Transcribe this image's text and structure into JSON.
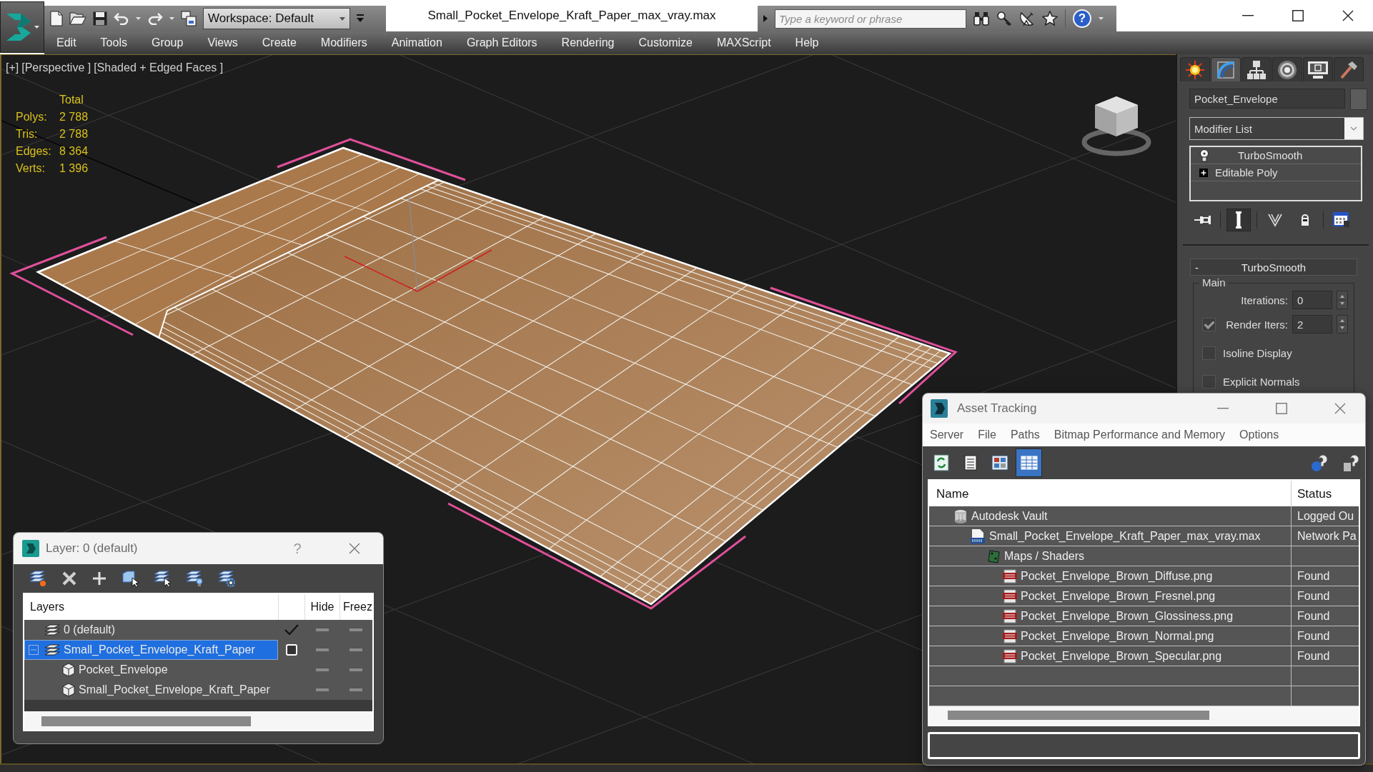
{
  "app": {
    "title": "Small_Pocket_Envelope_Kraft_Paper_max_vray.max",
    "workspace": "Workspace: Default",
    "search": {
      "placeholder": "Type a keyword or phrase"
    },
    "help_symbol": "?"
  },
  "menu": [
    "Edit",
    "Tools",
    "Group",
    "Views",
    "Create",
    "Modifiers",
    "Animation",
    "Graph Editors",
    "Rendering",
    "Customize",
    "MAXScript",
    "Help"
  ],
  "viewport": {
    "labels": [
      "[+]",
      "[Perspective ]",
      "[Shaded + Edged Faces ]"
    ],
    "stats": {
      "header": "Total",
      "rows": [
        {
          "label": "Polys:",
          "value": "2 788"
        },
        {
          "label": "Tris:",
          "value": "2 788"
        },
        {
          "label": "Edges:",
          "value": "8 364"
        },
        {
          "label": "Verts:",
          "value": "1 396"
        }
      ]
    }
  },
  "command_panel": {
    "tabs": [
      {
        "selected": false
      },
      {
        "selected": true
      },
      {
        "selected": false
      },
      {
        "selected": false
      },
      {
        "selected": false
      },
      {
        "selected": false
      }
    ],
    "object_name": "Pocket_Envelope",
    "modifier_list": "Modifier List",
    "stack": [
      {
        "kind": "modifier",
        "label": "TurboSmooth",
        "selected": false
      },
      {
        "kind": "base",
        "label": "Editable Poly",
        "selected": false
      }
    ],
    "stack_tools": [
      {
        "pressed": false
      },
      {
        "pressed": true
      },
      {
        "pressed": false
      },
      {
        "pressed": false
      },
      {
        "pressed": false
      }
    ],
    "rollout": {
      "sign": "-",
      "title": "TurboSmooth",
      "group": "Main",
      "rows": [
        {
          "kind": "spinner",
          "label": "Iterations:",
          "value": "0"
        },
        {
          "kind": "spinner",
          "label": "Render Iters:",
          "value": "2",
          "checked": true
        },
        {
          "kind": "checkbox",
          "label": "Isoline Display",
          "checked": false
        },
        {
          "kind": "checkbox",
          "label": "Explicit Normals",
          "checked": false
        }
      ]
    }
  },
  "asset_tracking": {
    "title": "Asset Tracking",
    "menu": [
      "Server",
      "File",
      "Paths",
      "Bitmap Performance and Memory",
      "Options"
    ],
    "toolbar": [
      {
        "selected": false
      },
      {
        "selected": false
      },
      {
        "selected": false
      },
      {
        "selected": true
      }
    ],
    "columns": [
      "Name",
      "Status"
    ],
    "tree": [
      {
        "kind": "vault",
        "name": "Autodesk Vault",
        "status": "Logged Ou",
        "selected": false,
        "children": [
          {
            "kind": "scene",
            "name": "Small_Pocket_Envelope_Kraft_Paper_max_vray.max",
            "status": "Network Pa",
            "selected": false,
            "children": [
              {
                "kind": "folder",
                "name": "Maps / Shaders",
                "selected": false,
                "children": [
                  {
                    "kind": "png",
                    "name": "Pocket_Envelope_Brown_Diffuse.png",
                    "status": "Found",
                    "selected": false
                  },
                  {
                    "kind": "png",
                    "name": "Pocket_Envelope_Brown_Fresnel.png",
                    "status": "Found",
                    "selected": false
                  },
                  {
                    "kind": "png",
                    "name": "Pocket_Envelope_Brown_Glossiness.png",
                    "status": "Found",
                    "selected": false
                  },
                  {
                    "kind": "png",
                    "name": "Pocket_Envelope_Brown_Normal.png",
                    "status": "Found",
                    "selected": false
                  },
                  {
                    "kind": "png",
                    "name": "Pocket_Envelope_Brown_Specular.png",
                    "status": "Found",
                    "selected": false
                  }
                ]
              }
            ]
          }
        ]
      }
    ]
  },
  "layer_dialog": {
    "title": "Layer: 0 (default)",
    "help": "?",
    "columns": [
      "Layers",
      "Hide",
      "Freez"
    ],
    "tree": [
      {
        "kind": "layer",
        "name": "0 (default)",
        "selected": false,
        "current": true,
        "hidden": false,
        "frozen": false
      },
      {
        "kind": "layer",
        "name": "Small_Pocket_Envelope_Kraft_Paper",
        "selected": true,
        "current": false,
        "expanded": true,
        "hidden": false,
        "frozen": false,
        "children": [
          {
            "kind": "object",
            "name": "Pocket_Envelope",
            "selected": false,
            "hidden": false,
            "frozen": false
          },
          {
            "kind": "object",
            "name": "Small_Pocket_Envelope_Kraft_Paper",
            "selected": false,
            "hidden": false,
            "frozen": false
          }
        ]
      }
    ]
  }
}
